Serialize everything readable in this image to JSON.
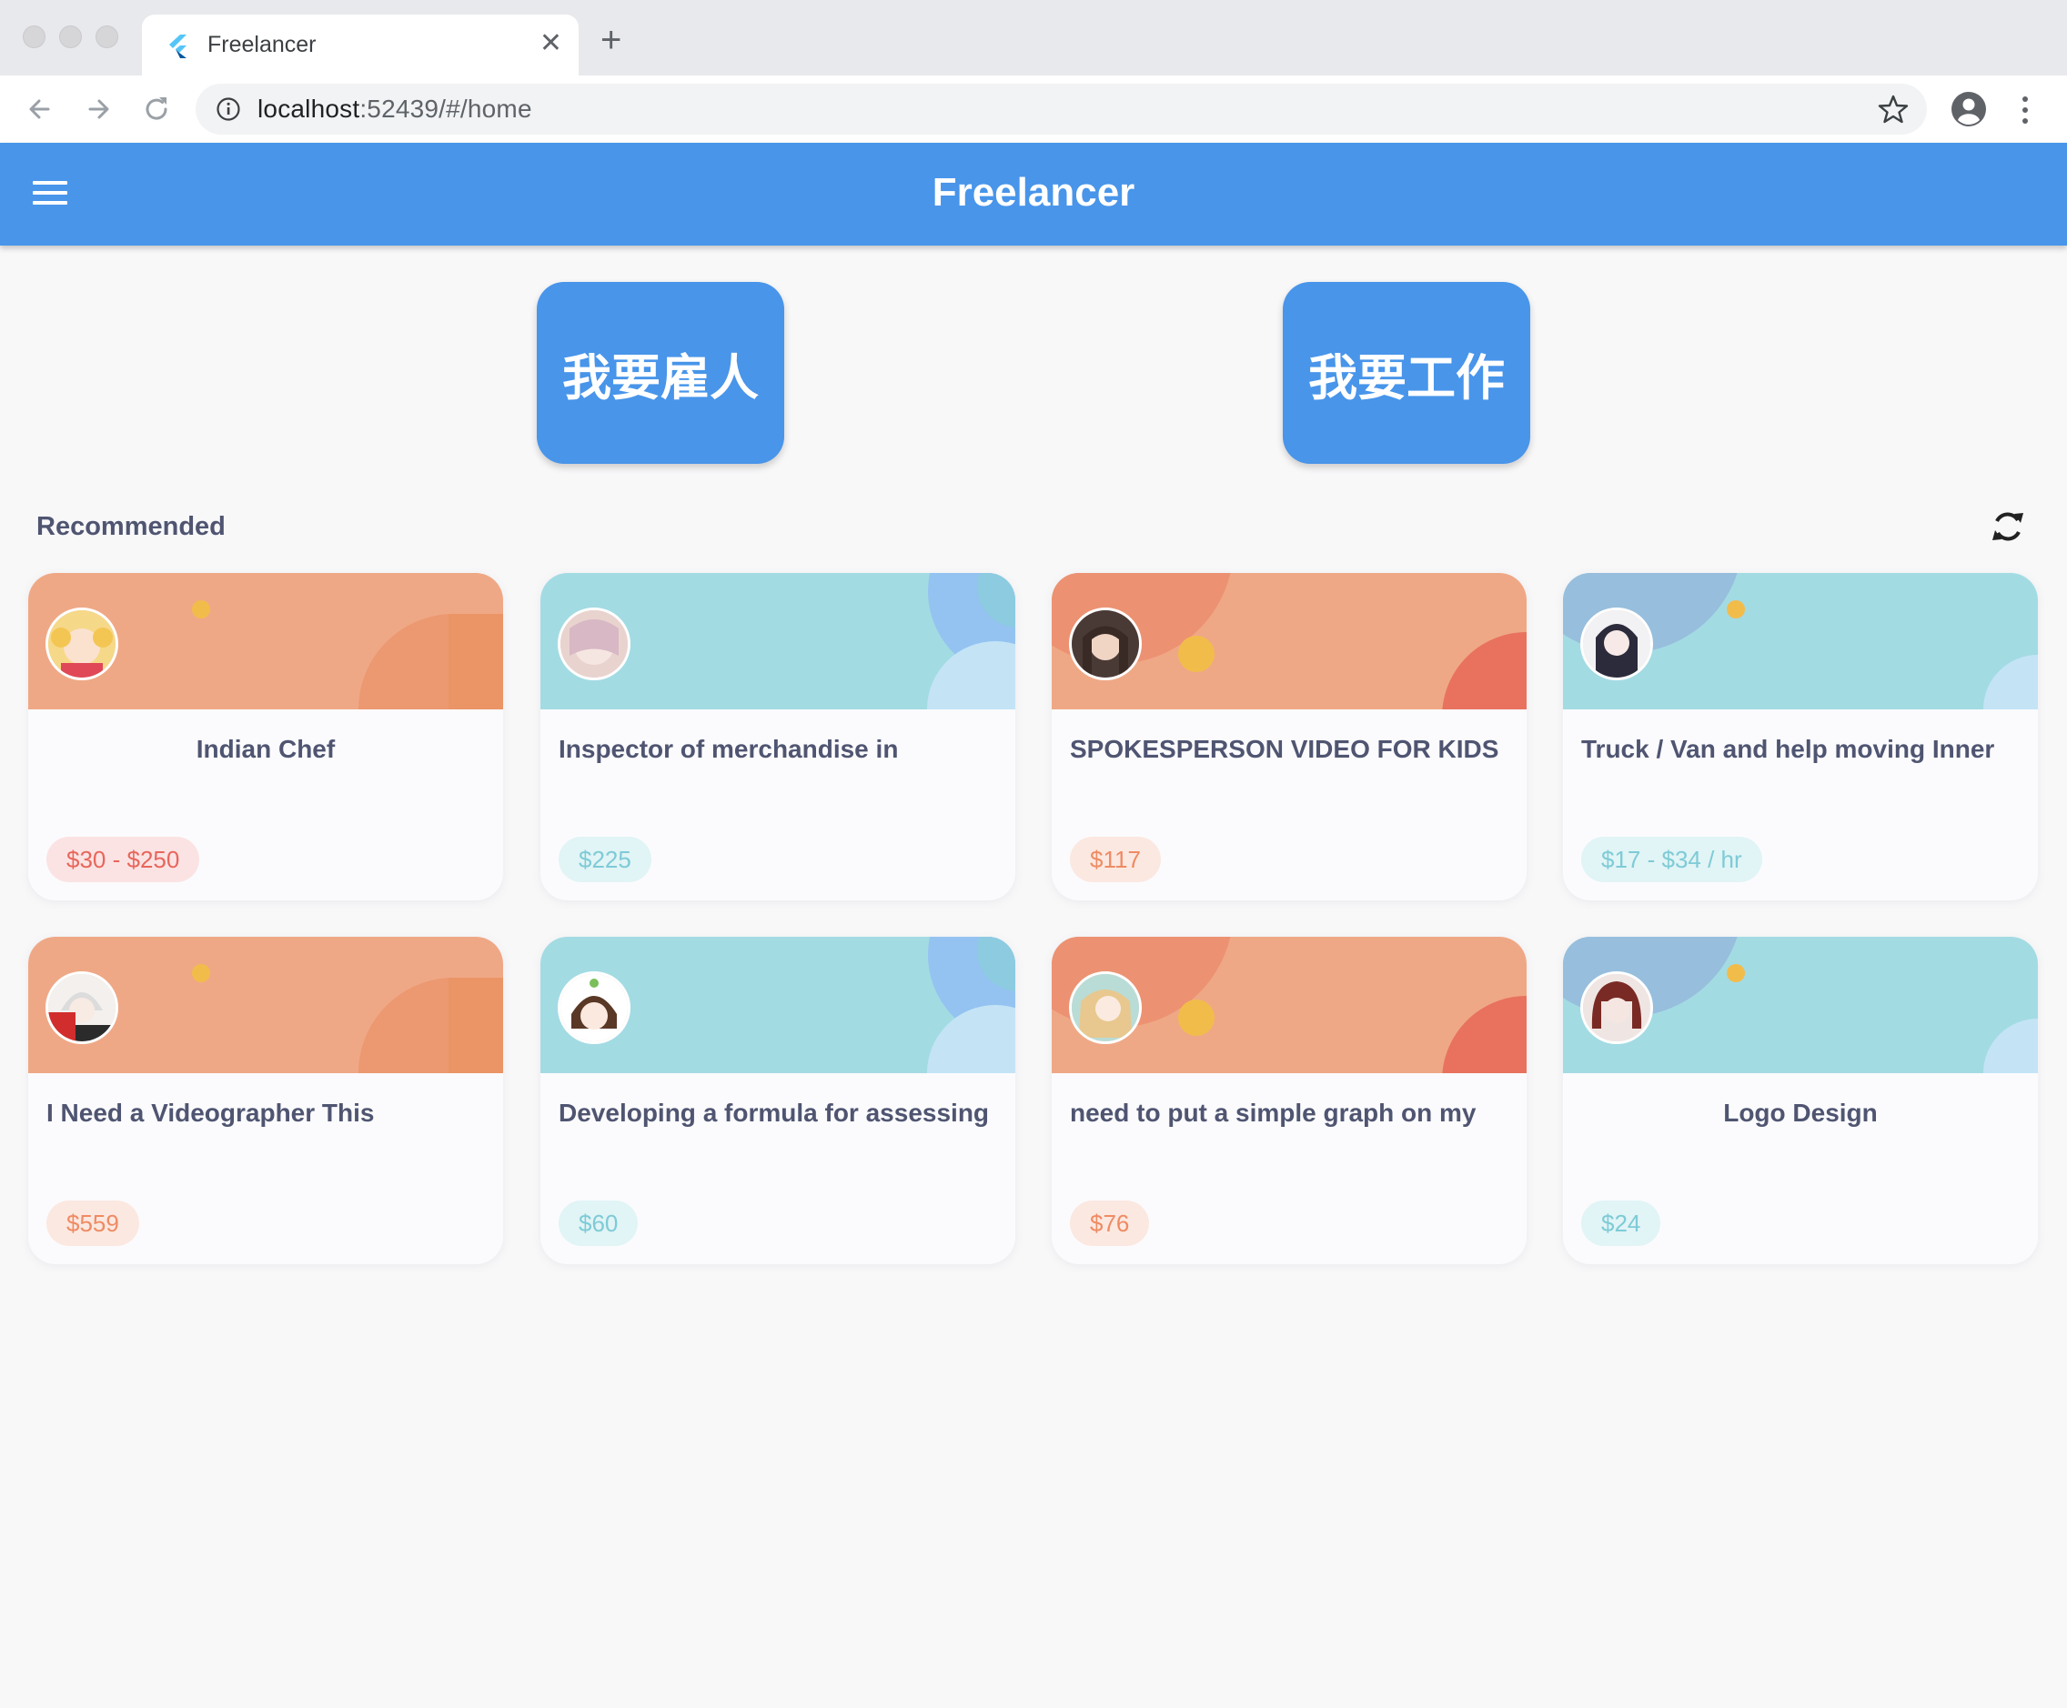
{
  "browser": {
    "tab_title": "Freelancer",
    "new_tab_symbol": "+",
    "close_symbol": "✕",
    "url_host": "localhost",
    "url_rest": ":52439/#/home"
  },
  "appbar": {
    "title": "Freelancer",
    "menu_icon": "hamburger-menu-icon"
  },
  "actions": {
    "hire_label": "我要雇人",
    "work_label": "我要工作"
  },
  "section": {
    "title": "Recommended",
    "refresh_icon": "refresh-icon"
  },
  "colors": {
    "appbar": "#4895ea",
    "orange_banner": "#efa886",
    "teal_banner": "#a3dbe3",
    "title_text": "#4f5571"
  },
  "cards": [
    {
      "title": "Indian Chef",
      "price": "$30 - $250"
    },
    {
      "title": "Inspector of merchandise in",
      "price": "$225"
    },
    {
      "title": "SPOKESPERSON VIDEO FOR KIDS",
      "price": "$117"
    },
    {
      "title": "Truck / Van and help moving Inner",
      "price": "$17 - $34 / hr"
    },
    {
      "title": "I Need a Videographer This",
      "price": "$559"
    },
    {
      "title": "Developing a formula for assessing",
      "price": "$60"
    },
    {
      "title": "need to put a simple graph on my",
      "price": "$76"
    },
    {
      "title": "Logo Design",
      "price": "$24"
    }
  ]
}
